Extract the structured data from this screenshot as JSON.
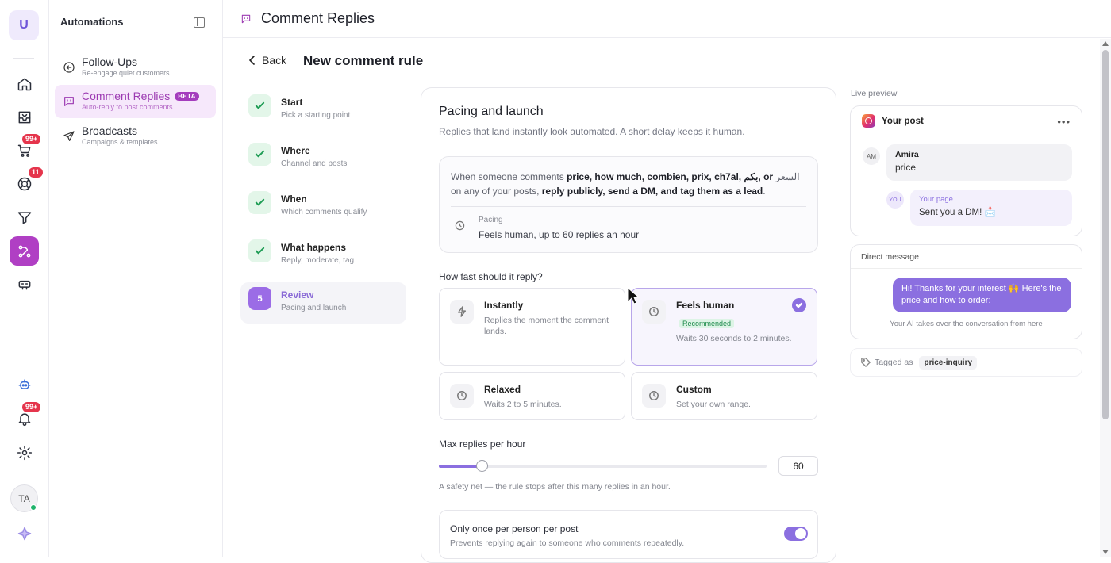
{
  "rail": {
    "logo": "U",
    "badges": {
      "cart": "99+",
      "support": "11",
      "notifications": "99+"
    },
    "avatar": "TA"
  },
  "sidebar": {
    "title": "Automations",
    "items": [
      {
        "label": "Follow-Ups",
        "sub": "Re-engage quiet customers",
        "icon": "follow-up-icon"
      },
      {
        "label": "Comment Replies",
        "badge": "BETA",
        "sub": "Auto-reply to post comments",
        "icon": "comment-icon",
        "active": true
      },
      {
        "label": "Broadcasts",
        "sub": "Campaigns & templates",
        "icon": "send-icon"
      }
    ]
  },
  "topbar": {
    "title": "Comment Replies"
  },
  "header": {
    "back_label": "Back",
    "page_title": "New comment rule"
  },
  "steps": [
    {
      "title": "Start",
      "sub": "Pick a starting point"
    },
    {
      "title": "Where",
      "sub": "Channel and posts"
    },
    {
      "title": "When",
      "sub": "Which comments qualify"
    },
    {
      "title": "What happens",
      "sub": "Reply, moderate, tag"
    },
    {
      "number": "5",
      "title": "Review",
      "sub": "Pacing and launch"
    }
  ],
  "main": {
    "title": "Pacing and launch",
    "subtitle": "Replies that land instantly look automated. A short delay keeps it human.",
    "summary": {
      "p1": "When someone comments ",
      "keywords": "price, how much, combien, prix, ch7al, بكم, or",
      "keyword_last": "السعر",
      "p2": " on any of your posts, ",
      "actions": "reply publicly, send a DM, and tag them as a lead",
      "p3": ".",
      "pacing_label": "Pacing",
      "pacing_value": "Feels human, up to 60 replies an hour"
    },
    "speed_question": "How fast should it reply?",
    "options": [
      {
        "title": "Instantly",
        "desc": "Replies the moment the comment lands.",
        "icon": "bolt-icon"
      },
      {
        "title": "Feels human",
        "badge": "Recommended",
        "desc": "Waits 30 seconds to 2 minutes.",
        "icon": "clock-icon",
        "selected": true
      },
      {
        "title": "Relaxed",
        "desc": "Waits 2 to 5 minutes.",
        "icon": "clock-icon"
      },
      {
        "title": "Custom",
        "desc": "Set your own range.",
        "icon": "clock-icon"
      }
    ],
    "max_label": "Max replies per hour",
    "max_value": "60",
    "slider_fraction": 0.13,
    "max_hint": "A safety net — the rule stops after this many replies in an hour.",
    "once": {
      "title": "Only once per person per post",
      "sub": "Prevents replying again to someone who comments repeatedly.",
      "enabled": true
    }
  },
  "preview": {
    "label": "Live preview",
    "post_title": "Your post",
    "comment": {
      "initials": "AM",
      "name": "Amira",
      "text": "price"
    },
    "reply": {
      "initials": "YOU",
      "name": "Your page",
      "text": "Sent you a DM! 📩"
    },
    "dm_title": "Direct message",
    "dm_text": "Hi! Thanks for your interest 🙌 Here's the price and how to order:",
    "dm_footer": "Your AI takes over the conversation from here",
    "tag_label": "Tagged as",
    "tag_value": "price-inquiry"
  },
  "colors": {
    "accent": "#8b6fe0",
    "brand": "#b03fc4",
    "success": "#1f9d55"
  }
}
